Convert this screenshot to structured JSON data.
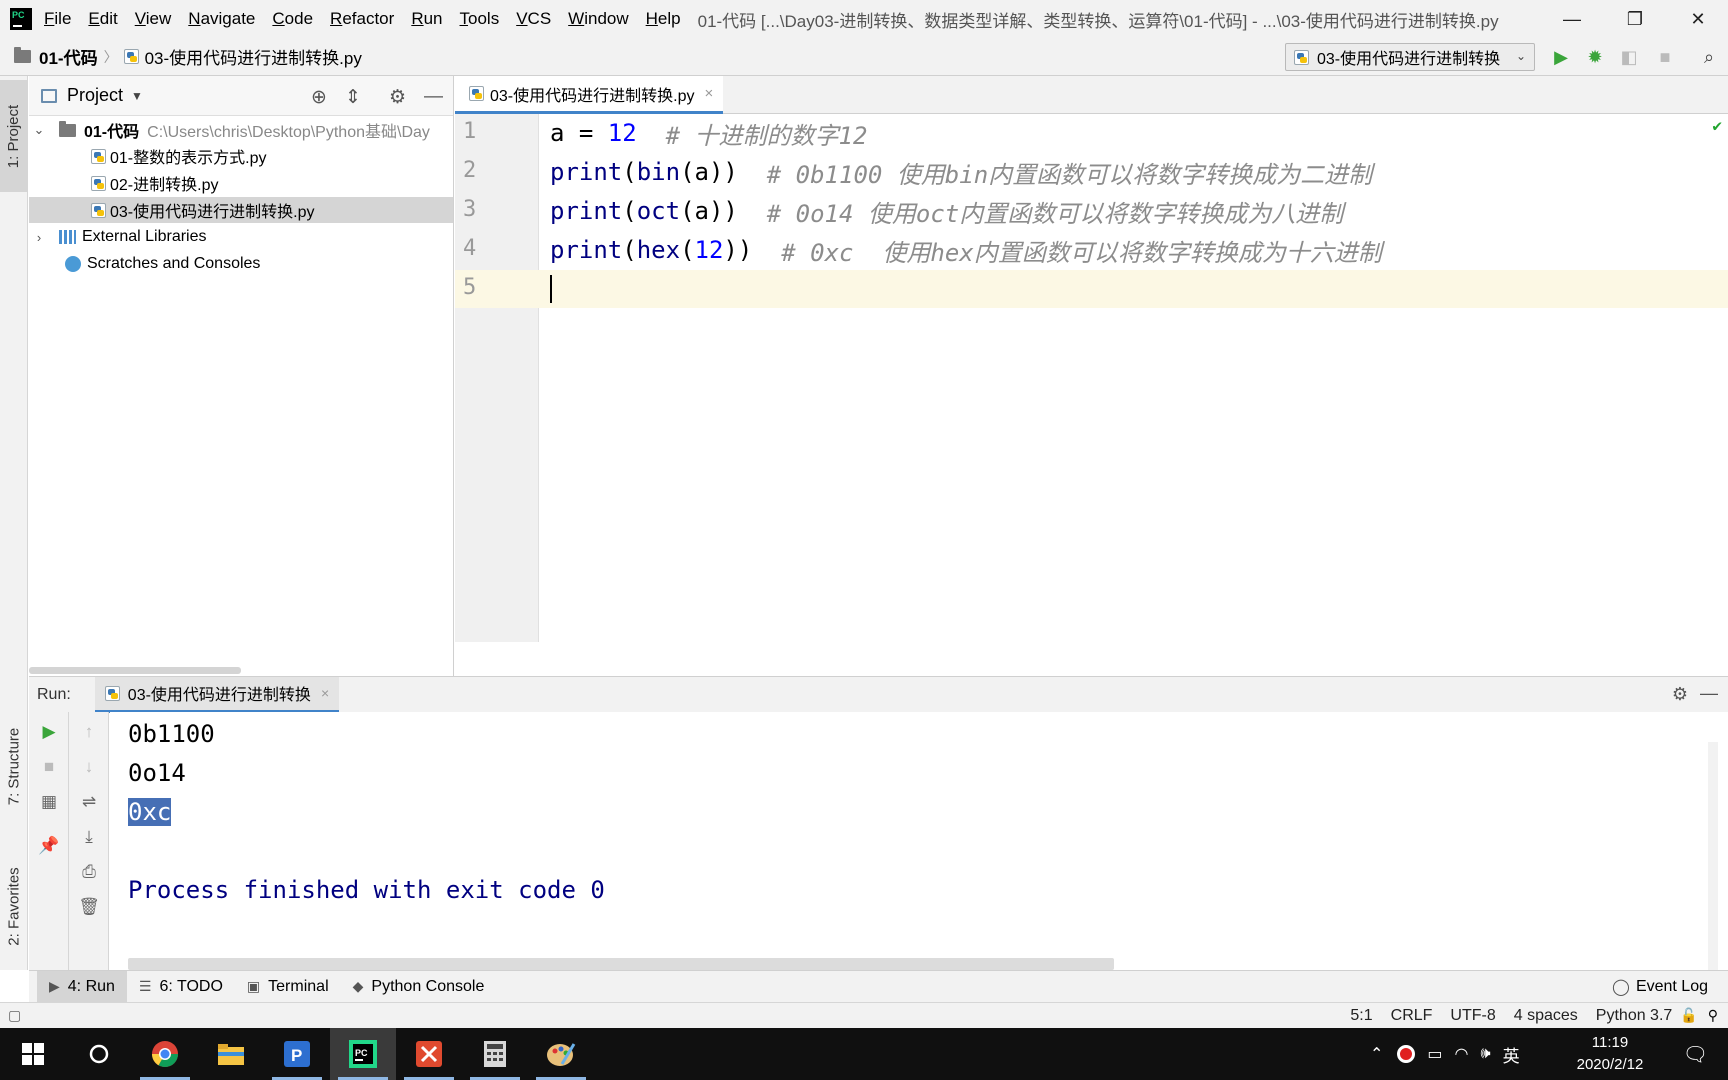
{
  "menu": {
    "items": [
      "File",
      "Edit",
      "View",
      "Navigate",
      "Code",
      "Refactor",
      "Run",
      "Tools",
      "VCS",
      "Window",
      "Help"
    ],
    "window_title": "01-代码 [...\\Day03-进制转换、数据类型详解、类型转换、运算符\\01-代码] - ...\\03-使用代码进行进制转换.py"
  },
  "window_controls": {
    "minimize": "—",
    "restore": "❐",
    "close": "✕"
  },
  "navbar": {
    "project": "01-代码",
    "file": "03-使用代码进行进制转换.py",
    "run_config": "03-使用代码进行进制转换"
  },
  "sidebar": {
    "project_tab": "1: Project",
    "structure_tab": "7: Structure",
    "favorites_tab": "2: Favorites"
  },
  "project_panel": {
    "title": "Project",
    "root": {
      "name": "01-代码",
      "path": "C:\\Users\\chris\\Desktop\\Python基础\\Day"
    },
    "files": [
      "01-整数的表示方式.py",
      "02-进制转换.py",
      "03-使用代码进行进制转换.py"
    ],
    "external_libraries": "External Libraries",
    "scratches": "Scratches and Consoles"
  },
  "editor": {
    "tab": "03-使用代码进行进制转换.py",
    "line_numbers": [
      "1",
      "2",
      "3",
      "4",
      "5"
    ],
    "lines": [
      [
        {
          "t": "a = ",
          "c": "plain"
        },
        {
          "t": "12",
          "c": "num"
        },
        {
          "t": "  # 十进制的数字12",
          "c": "cmt"
        }
      ],
      [
        {
          "t": "print",
          "c": "kw"
        },
        {
          "t": "(",
          "c": "plain"
        },
        {
          "t": "bin",
          "c": "kw"
        },
        {
          "t": "(a))",
          "c": "plain"
        },
        {
          "t": "  # 0b1100 使用bin内置函数可以将数字转换成为二进制",
          "c": "cmt"
        }
      ],
      [
        {
          "t": "print",
          "c": "kw"
        },
        {
          "t": "(",
          "c": "plain"
        },
        {
          "t": "oct",
          "c": "kw"
        },
        {
          "t": "(a))",
          "c": "plain"
        },
        {
          "t": "  # 0o14 使用oct内置函数可以将数字转换成为八进制",
          "c": "cmt"
        }
      ],
      [
        {
          "t": "print",
          "c": "kw"
        },
        {
          "t": "(",
          "c": "plain"
        },
        {
          "t": "hex",
          "c": "kw"
        },
        {
          "t": "(",
          "c": "plain"
        },
        {
          "t": "12",
          "c": "num"
        },
        {
          "t": "))",
          "c": "plain"
        },
        {
          "t": "  # 0xc  使用hex内置函数可以将数字转换成为十六进制",
          "c": "cmt"
        }
      ],
      []
    ]
  },
  "run_panel": {
    "label": "Run:",
    "tab": "03-使用代码进行进制转换",
    "output": [
      "0b1100",
      "0o14",
      "0xc",
      "",
      "Process finished with exit code 0"
    ]
  },
  "tool_windows": {
    "run": "4: Run",
    "todo": "6: TODO",
    "terminal": "Terminal",
    "python_console": "Python Console",
    "event_log": "Event Log"
  },
  "status": {
    "position": "5:1",
    "line_sep": "CRLF",
    "encoding": "UTF-8",
    "indent": "4 spaces",
    "interpreter": "Python 3.7"
  },
  "taskbar": {
    "ime": "英",
    "time": "11:19",
    "date": "2020/2/12"
  },
  "colors": {
    "keyword": "#000080",
    "number": "#0000ff",
    "comment": "#8c8c8c",
    "selection": "#466fb5",
    "current_line": "#fcf8e4",
    "accent": "#4083c9"
  }
}
